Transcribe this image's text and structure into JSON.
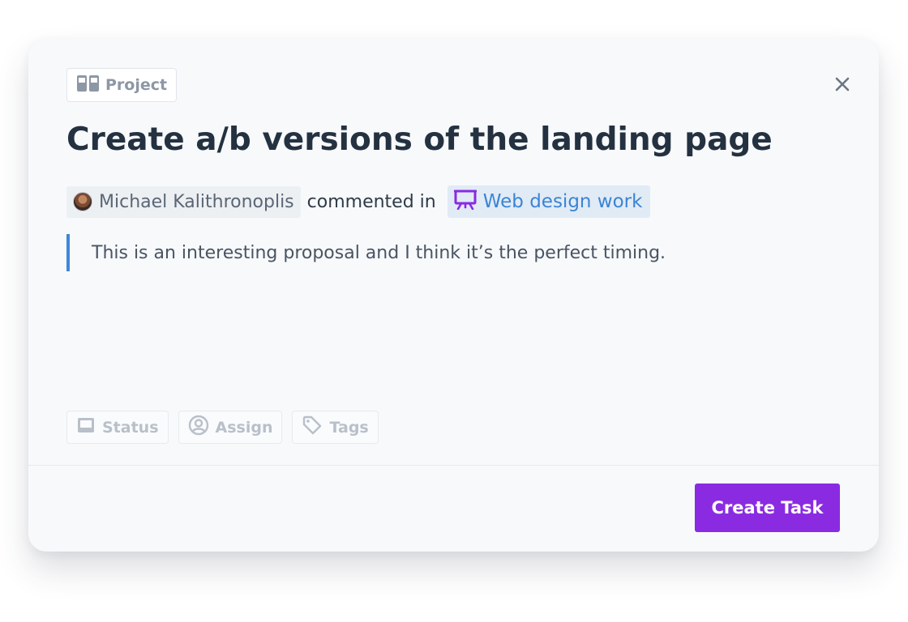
{
  "dialog": {
    "badge_label": "Project",
    "title": "Create a/b versions of the landing page",
    "author_name": "Michael Kalithronoplis",
    "action_text": "commented in",
    "reference_label": "Web design work",
    "comment_text": "This is an interesting proposal and I think it’s the perfect timing.",
    "actions": [
      {
        "label": "Status",
        "icon": "inbox-icon"
      },
      {
        "label": "Assign",
        "icon": "user-circle-icon"
      },
      {
        "label": "Tags",
        "icon": "tag-icon"
      }
    ],
    "submit_label": "Create Task"
  },
  "colors": {
    "accent": "#8a2be2",
    "link": "#3b84d4",
    "quote_bar": "#3f87da",
    "title": "#243140"
  }
}
